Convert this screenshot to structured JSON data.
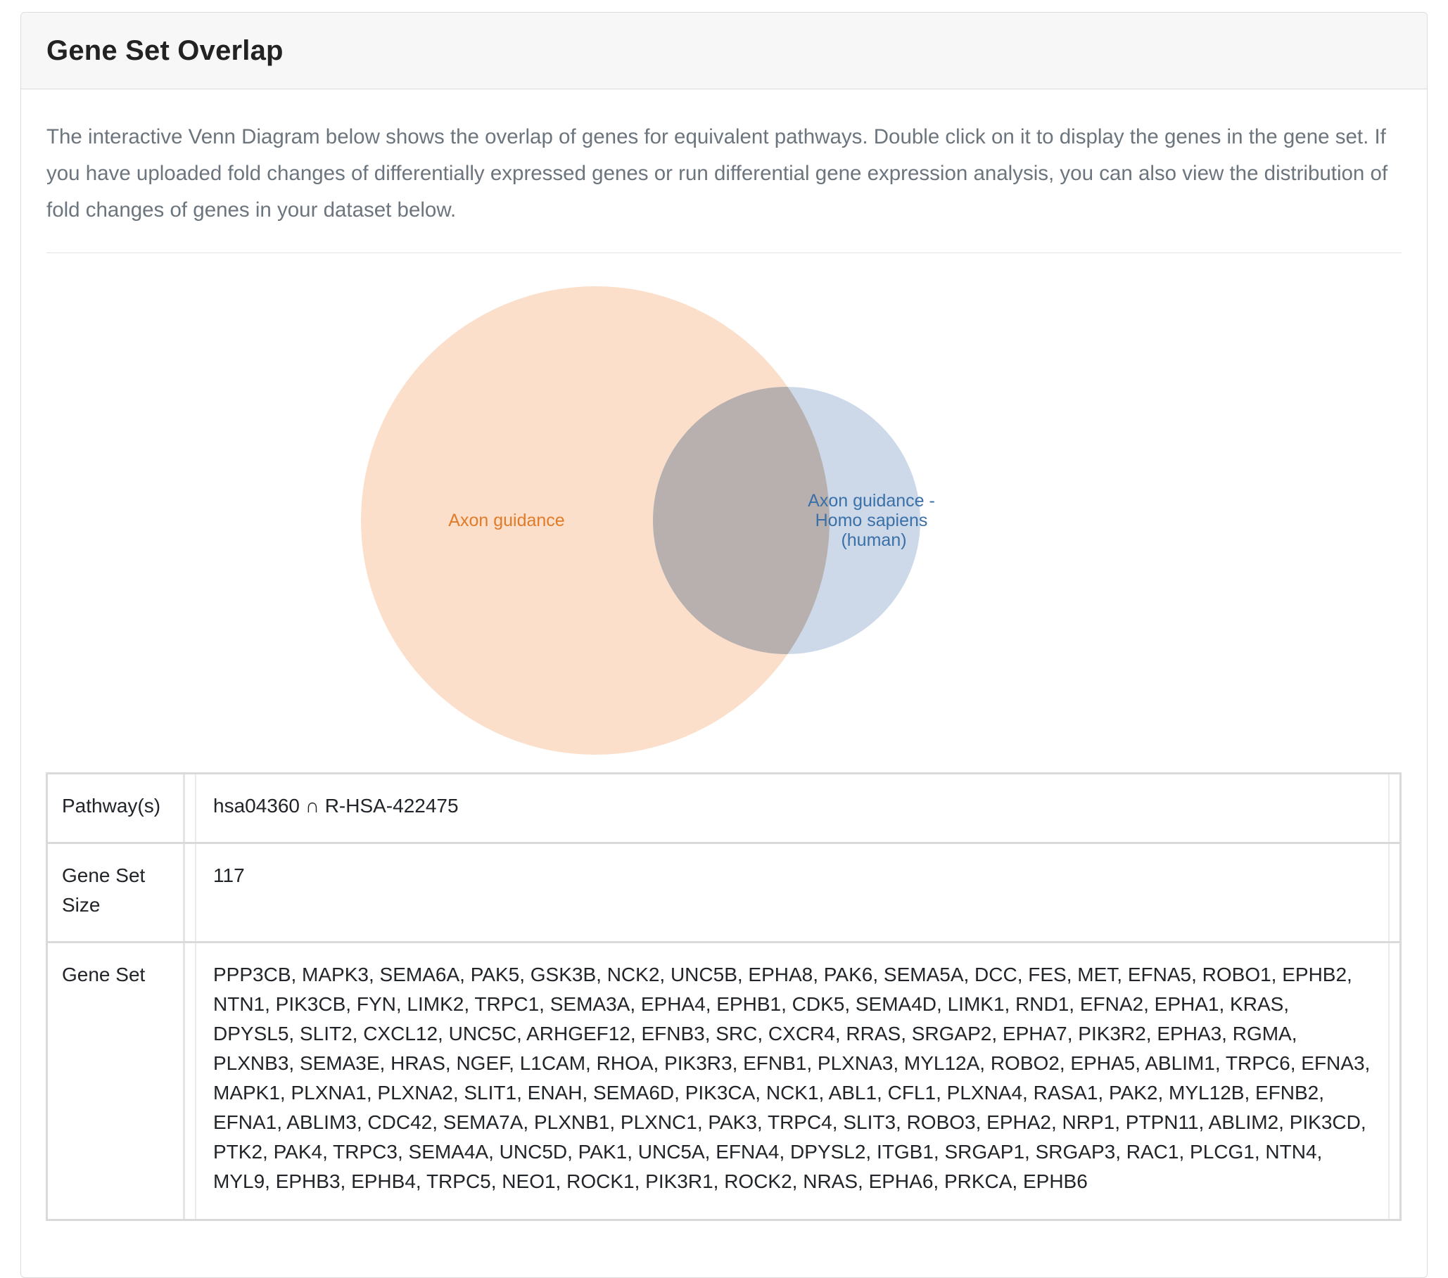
{
  "card": {
    "title": "Gene Set Overlap",
    "intro": "The interactive Venn Diagram below shows the overlap of genes for equivalent pathways. Double click on it to display the genes in the gene set. If you have uploaded fold changes of differentially expressed genes or run differential gene expression analysis, you can also view the distribution of fold changes of genes in your dataset below."
  },
  "venn": {
    "set_a": {
      "label": "Axon guidance",
      "fill_color": "#fbdfca",
      "label_color": "#e07b2a"
    },
    "set_b": {
      "label_lines": [
        "Axon guidance -",
        "Homo sapiens",
        "(human)"
      ],
      "fill_color": "#cdd9e9",
      "label_color": "#3a70a8"
    },
    "intersection_color": "#b8b0ae"
  },
  "table": {
    "rows": [
      {
        "label": "Pathway(s)",
        "value": "hsa04360 ∩ R-HSA-422475"
      },
      {
        "label": "Gene Set Size",
        "value": "117"
      },
      {
        "label": "Gene Set",
        "value": "PPP3CB, MAPK3, SEMA6A, PAK5, GSK3B, NCK2, UNC5B, EPHA8, PAK6, SEMA5A, DCC, FES, MET, EFNA5, ROBO1, EPHB2, NTN1, PIK3CB, FYN, LIMK2, TRPC1, SEMA3A, EPHA4, EPHB1, CDK5, SEMA4D, LIMK1, RND1, EFNA2, EPHA1, KRAS, DPYSL5, SLIT2, CXCL12, UNC5C, ARHGEF12, EFNB3, SRC, CXCR4, RRAS, SRGAP2, EPHA7, PIK3R2, EPHA3, RGMA, PLXNB3, SEMA3E, HRAS, NGEF, L1CAM, RHOA, PIK3R3, EFNB1, PLXNA3, MYL12A, ROBO2, EPHA5, ABLIM1, TRPC6, EFNA3, MAPK1, PLXNA1, PLXNA2, SLIT1, ENAH, SEMA6D, PIK3CA, NCK1, ABL1, CFL1, PLXNA4, RASA1, PAK2, MYL12B, EFNB2, EFNA1, ABLIM3, CDC42, SEMA7A, PLXNB1, PLXNC1, PAK3, TRPC4, SLIT3, ROBO3, EPHA2, NRP1, PTPN11, ABLIM2, PIK3CD, PTK2, PAK4, TRPC3, SEMA4A, UNC5D, PAK1, UNC5A, EFNA4, DPYSL2, ITGB1, SRGAP1, SRGAP3, RAC1, PLCG1, NTN4, MYL9, EPHB3, EPHB4, TRPC5, NEO1, ROCK1, PIK3R1, ROCK2, NRAS, EPHA6, PRKCA, EPHB6"
      }
    ]
  }
}
